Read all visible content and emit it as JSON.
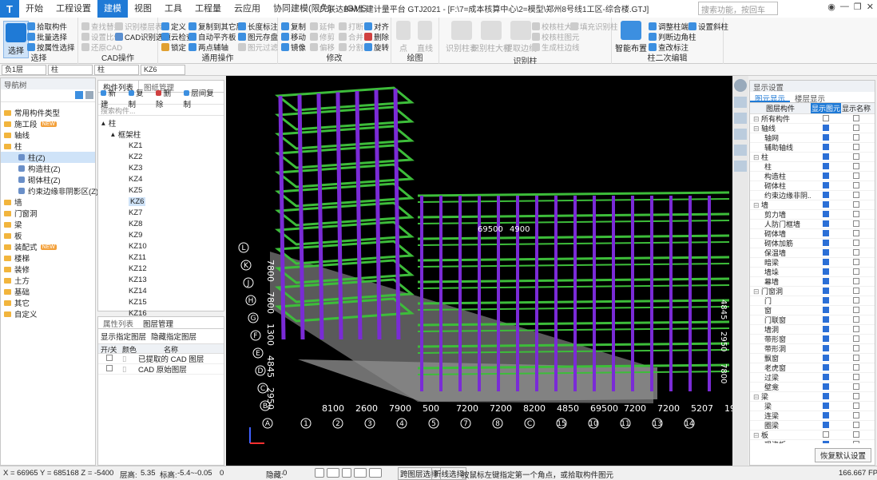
{
  "window": {
    "title": "广联达BIM土建计量平台 GTJ2021 - [F:\\7=成本核算中心\\2=模型\\郑州8号线1工区-综合楼.GTJ]",
    "search_placeholder": "搜索功能，按回车",
    "logo": "T"
  },
  "menu_tabs": [
    "开始",
    "工程设置",
    "建模",
    "视图",
    "工具",
    "工程量",
    "云应用",
    "协同建模(限免)",
    "IGMS"
  ],
  "ribbon": {
    "select": {
      "big": "选择",
      "items": [
        "拾取构件",
        "批量选择",
        "按属性选择"
      ],
      "label": "选择"
    },
    "cad": {
      "items": [
        "查找替换",
        "设置比例",
        "还原CAD",
        "识别楼层表",
        "CAD识别选项"
      ],
      "label": "CAD操作"
    },
    "common": {
      "items": [
        "定义",
        "云检查",
        "锁定",
        "复制到其它层",
        "自动平齐板",
        "两点辅轴",
        "长度标注",
        "图元存盘",
        "图元过滤"
      ],
      "label": "通用操作"
    },
    "modify": {
      "items": [
        "复制",
        "移动",
        "镜像",
        "延伸",
        "修剪",
        "偏移",
        "打断",
        "合并",
        "分割",
        "对齐",
        "删除",
        "旋转"
      ],
      "label": "修改"
    },
    "draw": {
      "items": [
        "点",
        "直线"
      ],
      "label": "绘图"
    },
    "identify": {
      "items": [
        "识别柱表",
        "识别柱大样",
        "提取边线",
        "校核柱大样",
        "校核柱图元",
        "生成柱边线",
        "填充识别柱"
      ],
      "label": "识别柱"
    },
    "second": {
      "items": [
        "智能布置",
        "调整柱端头",
        "判断边角柱",
        "查改标注",
        "设置斜柱"
      ],
      "label": "柱二次编辑"
    }
  },
  "selectors": [
    "负1层",
    "柱",
    "柱",
    "KZ6"
  ],
  "nav": {
    "title": "导航树",
    "items": [
      "常用构件类型",
      "施工段",
      "轴线",
      "柱",
      "柱(Z)",
      "构造柱(Z)",
      "砌体柱(Z)",
      "约束边缘非阴影区(Z)",
      "墙",
      "门窗洞",
      "梁",
      "板",
      "装配式",
      "楼梯",
      "装修",
      "土方",
      "基础",
      "其它",
      "自定义"
    ],
    "new_badge": "NEW"
  },
  "component_list": {
    "tabs": [
      "构件列表",
      "图纸管理"
    ],
    "toolbar": [
      "新建",
      "复制",
      "删除",
      "层间复制"
    ],
    "search_placeholder": "搜索构件...",
    "root": "柱",
    "group": "框架柱",
    "items": [
      "KZ1",
      "KZ2",
      "KZ3",
      "KZ4",
      "KZ5",
      "KZ6",
      "KZ7",
      "KZ8",
      "KZ9",
      "KZ10",
      "KZ11",
      "KZ12",
      "KZ13",
      "KZ14",
      "KZ15",
      "KZ16"
    ]
  },
  "layer_panel": {
    "tabs": [
      "属性列表",
      "图层管理"
    ],
    "options": [
      "显示指定图层",
      "隐藏指定图层"
    ],
    "columns": [
      "开/关",
      "颜色",
      "名称"
    ],
    "rows": [
      "已提取的 CAD 图层",
      "CAD 原始图层"
    ]
  },
  "display_settings": {
    "title": "显示设置",
    "tabs": [
      "图元显示",
      "楼层显示"
    ],
    "columns": [
      "图层构件",
      "显示图元",
      "显示名称"
    ],
    "rows": [
      {
        "name": "所有构件",
        "level": 0,
        "group": true
      },
      {
        "name": "轴线",
        "level": 0,
        "group": true
      },
      {
        "name": "轴网",
        "level": 1
      },
      {
        "name": "辅助轴线",
        "level": 1
      },
      {
        "name": "柱",
        "level": 0,
        "group": true
      },
      {
        "name": "柱",
        "level": 1
      },
      {
        "name": "构造柱",
        "level": 1
      },
      {
        "name": "砌体柱",
        "level": 1
      },
      {
        "name": "约束边缘非阴...",
        "level": 1
      },
      {
        "name": "墙",
        "level": 0,
        "group": true
      },
      {
        "name": "剪力墙",
        "level": 1
      },
      {
        "name": "人防门框墙",
        "level": 1
      },
      {
        "name": "砌体墙",
        "level": 1
      },
      {
        "name": "砌体加筋",
        "level": 1
      },
      {
        "name": "保温墙",
        "level": 1
      },
      {
        "name": "暗梁",
        "level": 1
      },
      {
        "name": "墙垛",
        "level": 1
      },
      {
        "name": "幕墙",
        "level": 1
      },
      {
        "name": "门窗洞",
        "level": 0,
        "group": true
      },
      {
        "name": "门",
        "level": 1
      },
      {
        "name": "窗",
        "level": 1
      },
      {
        "name": "门联窗",
        "level": 1
      },
      {
        "name": "墙洞",
        "level": 1
      },
      {
        "name": "带形窗",
        "level": 1
      },
      {
        "name": "带形洞",
        "level": 1
      },
      {
        "name": "飘窗",
        "level": 1
      },
      {
        "name": "老虎窗",
        "level": 1
      },
      {
        "name": "过梁",
        "level": 1
      },
      {
        "name": "壁龛",
        "level": 1
      },
      {
        "name": "梁",
        "level": 0,
        "group": true
      },
      {
        "name": "梁",
        "level": 1
      },
      {
        "name": "连梁",
        "level": 1
      },
      {
        "name": "圈梁",
        "level": 1
      },
      {
        "name": "板",
        "level": 0,
        "group": true
      },
      {
        "name": "现浇板",
        "level": 1
      }
    ],
    "restore": "恢复默认设置"
  },
  "viewport": {
    "dims_bottom": [
      "8100",
      "2600",
      "7900",
      "500",
      "7200",
      "7200",
      "8200",
      "4850",
      "69500",
      "7200",
      "7200",
      "5207",
      "1993"
    ],
    "axes_bottom": [
      "1",
      "2",
      "3",
      "4",
      "5",
      "7",
      "8",
      "C",
      "15",
      "10",
      "11",
      "13",
      "14"
    ],
    "axes_left": [
      "L",
      "K",
      "J",
      "H",
      "G",
      "F",
      "E",
      "D",
      "C",
      "B",
      "A"
    ],
    "dims_left": [
      "7800",
      "7800",
      "1300",
      "4845",
      "2950"
    ],
    "top_dims": [
      "69500",
      "4900"
    ],
    "side_dims": [
      "4845",
      "2950",
      "7800"
    ]
  },
  "status": {
    "coords": "X = 66965 Y = 685168 Z = -5400",
    "floor_h_label": "层高:",
    "floor_h": "5.35",
    "elev_label": "标高:",
    "elev": "-5.4~-0.05",
    "zero": "0",
    "hidden_label": "隐藏:",
    "hidden": "0",
    "cross_layer": "跨图层选择",
    "polyline_sel": "折线选择",
    "hint": "按鼠标左键指定第一个角点，或拾取构件图元",
    "fps": "166.667 FPS"
  },
  "colors": {
    "accent": "#1f7ad6",
    "beam_green": "#3dbd3a",
    "column_purple": "#7a2bd6",
    "slab_gray": "#8c8c8c"
  }
}
